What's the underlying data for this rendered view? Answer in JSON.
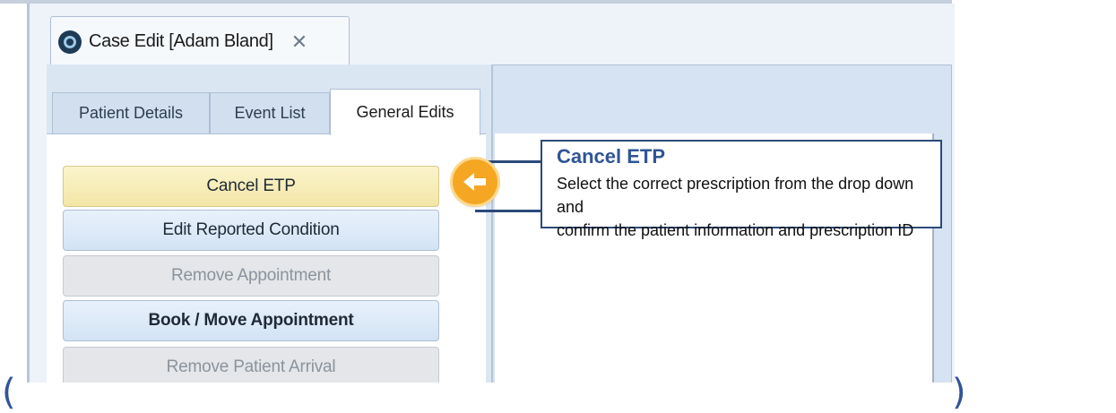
{
  "document_tab": {
    "title": "Case Edit [Adam Bland]",
    "close_symbol": "✕"
  },
  "tabs": [
    {
      "label": "Patient Details",
      "active": false
    },
    {
      "label": "Event List",
      "active": false
    },
    {
      "label": "General Edits",
      "active": true
    }
  ],
  "buttons": [
    {
      "label": "Cancel ETP",
      "state": "highlighted"
    },
    {
      "label": "Edit Reported Condition",
      "state": "enabled"
    },
    {
      "label": "Remove Appointment",
      "state": "disabled"
    },
    {
      "label": "Book / Move Appointment",
      "state": "enabled"
    },
    {
      "label": "Remove Patient Arrival",
      "state": "disabled"
    }
  ],
  "callout": {
    "title": "Cancel ETP",
    "text_line1": "Select the correct prescription from the drop down and",
    "text_line2": "confirm the patient information and prescription ID",
    "pointer_icon": "arrow-left-icon"
  },
  "decor": {
    "left_paren": "(",
    "right_paren": ")"
  },
  "colors": {
    "accent": "#2f5597",
    "highlight": "#f2e6a6",
    "pointer": "#f5a623"
  }
}
